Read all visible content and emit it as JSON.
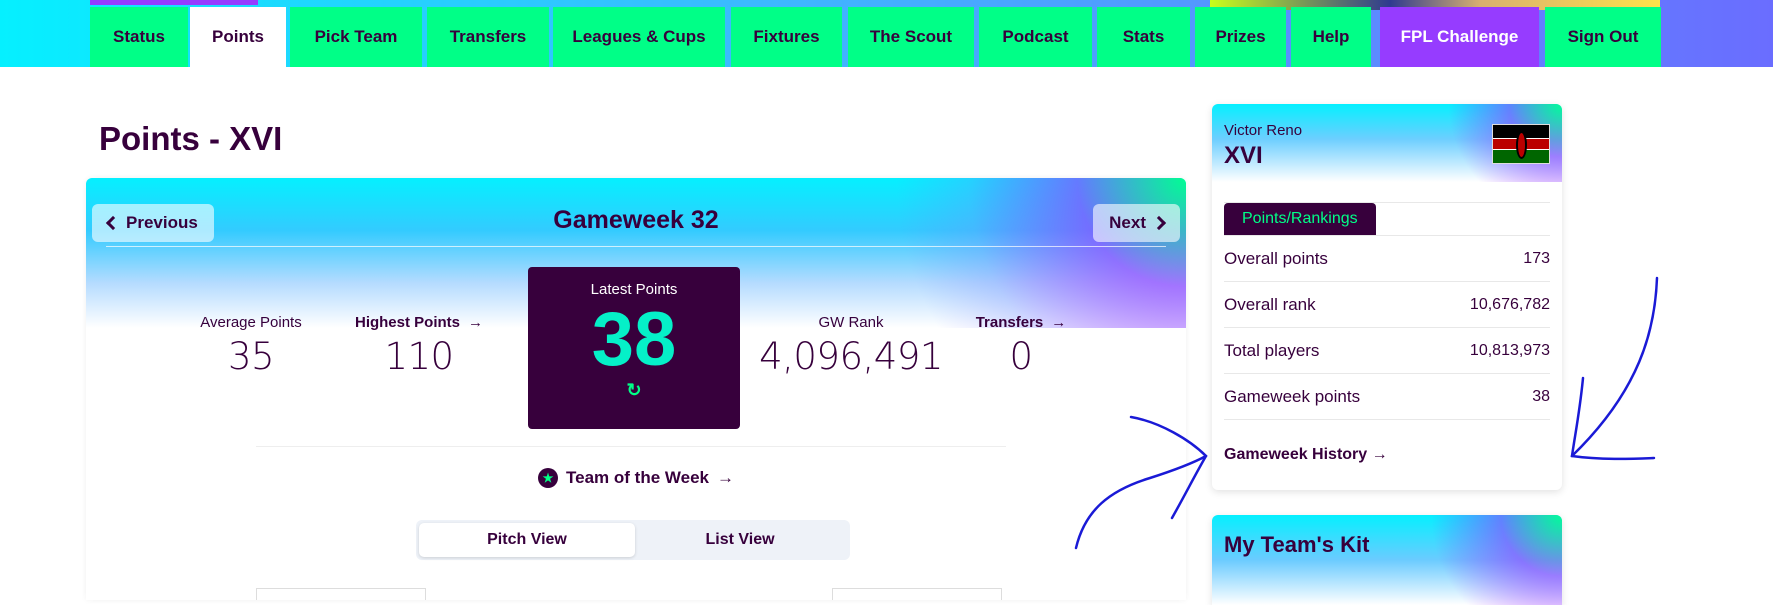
{
  "nav": {
    "tabs": [
      {
        "label": "Status",
        "active": false
      },
      {
        "label": "Points",
        "active": true
      },
      {
        "label": "Pick Team",
        "active": false
      },
      {
        "label": "Transfers",
        "active": false
      },
      {
        "label": "Leagues & Cups",
        "active": false
      },
      {
        "label": "Fixtures",
        "active": false
      },
      {
        "label": "The Scout",
        "active": false
      },
      {
        "label": "Podcast",
        "active": false
      },
      {
        "label": "Stats",
        "active": false
      },
      {
        "label": "Prizes",
        "active": false
      },
      {
        "label": "Help",
        "active": false
      },
      {
        "label": "FPL Challenge",
        "active": false
      },
      {
        "label": "Sign Out",
        "active": false
      }
    ]
  },
  "page": {
    "title": "Points - XVI"
  },
  "gameweek": {
    "title": "Gameweek 32",
    "prev_label": "Previous",
    "next_label": "Next"
  },
  "stats": {
    "average": {
      "label": "Average Points",
      "value": "35"
    },
    "highest": {
      "label": "Highest Points",
      "value": "110"
    },
    "latest": {
      "label": "Latest Points",
      "value": "38"
    },
    "gw_rank": {
      "label": "GW Rank",
      "value": "4,096,491"
    },
    "transfers": {
      "label": "Transfers",
      "value": "0"
    }
  },
  "team_of_week": {
    "label": "Team of the Week",
    "arrow": "→"
  },
  "view_toggle": {
    "pitch": "Pitch View",
    "list": "List View"
  },
  "sidebar": {
    "manager_name": "Victor Reno",
    "team_name": "XVI",
    "tab_label": "Points/Rankings",
    "rows": [
      {
        "label": "Overall points",
        "value": "173"
      },
      {
        "label": "Overall rank",
        "value": "10,676,782"
      },
      {
        "label": "Total players",
        "value": "10,813,973"
      },
      {
        "label": "Gameweek points",
        "value": "38"
      }
    ],
    "history_link": "Gameweek History",
    "history_arrow": "→"
  },
  "kit": {
    "title": "My Team's Kit"
  },
  "colors": {
    "brand_purple": "#37003c",
    "brand_green": "#00ff87",
    "accent_cyan": "#05f0ff",
    "challenge_purple": "#963cff",
    "annotation_blue": "#1a1ad6"
  }
}
